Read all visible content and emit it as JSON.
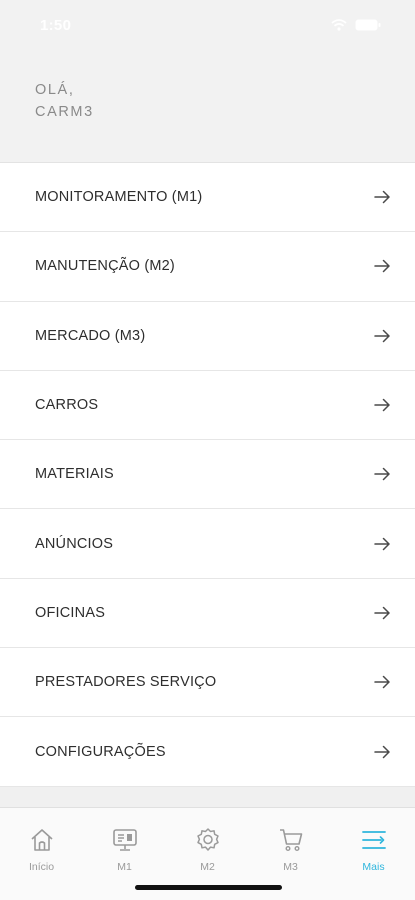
{
  "status_bar": {
    "time": "1:50"
  },
  "greeting": {
    "line1": "OLÁ,",
    "line2": "CARM3"
  },
  "menu": {
    "items": [
      {
        "label": "MONITORAMENTO (M1)"
      },
      {
        "label": "MANUTENÇÃO (M2)"
      },
      {
        "label": "MERCADO (M3)"
      },
      {
        "label": "CARROS"
      },
      {
        "label": "MATERIAIS"
      },
      {
        "label": "ANÚNCIOS"
      },
      {
        "label": "OFICINAS"
      },
      {
        "label": "PRESTADORES SERVIÇO"
      },
      {
        "label": "CONFIGURAÇÕES"
      }
    ],
    "arrow_icon": "arrow-right-icon"
  },
  "tab_bar": {
    "tabs": [
      {
        "label": "Início",
        "icon": "home-icon",
        "active": false
      },
      {
        "label": "M1",
        "icon": "monitor-icon",
        "active": false
      },
      {
        "label": "M2",
        "icon": "gear-icon",
        "active": false
      },
      {
        "label": "M3",
        "icon": "cart-icon",
        "active": false
      },
      {
        "label": "Mais",
        "icon": "menu-more-icon",
        "active": true
      }
    ]
  },
  "colors": {
    "accent": "#2fb6dd",
    "inactive": "#9a9a9a",
    "header_bg": "#f2f2f2"
  }
}
